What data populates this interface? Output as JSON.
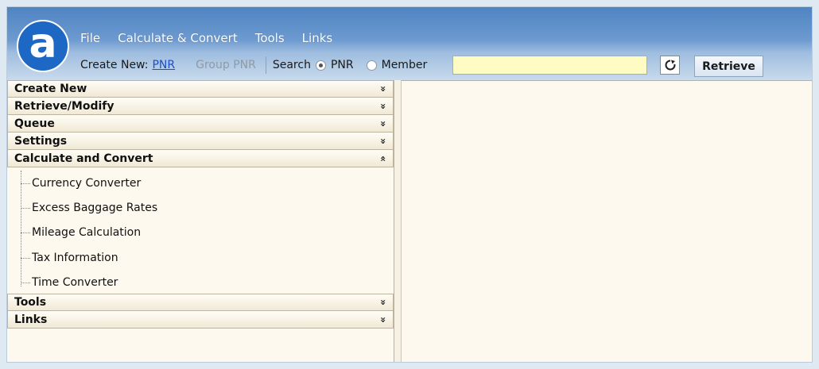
{
  "app": {
    "logo_letter": "a"
  },
  "menu": [
    "File",
    "Calculate & Convert",
    "Tools",
    "Links"
  ],
  "toolbar": {
    "create_new_label": "Create New:",
    "pnr_link": "PNR",
    "group_pnr": "Group PNR",
    "search_label": "Search",
    "radio_pnr": {
      "label": "PNR",
      "checked": true
    },
    "radio_member": {
      "label": "Member",
      "checked": false
    },
    "search_value": "",
    "search_placeholder": "",
    "retrieve_label": "Retrieve"
  },
  "icons": {
    "refresh": "refresh-icon",
    "expand": "double-chevron-down-icon",
    "collapse": "double-chevron-up-icon"
  },
  "sidebar": {
    "sections": [
      {
        "label": "Create New",
        "expanded": false
      },
      {
        "label": "Retrieve/Modify",
        "expanded": false
      },
      {
        "label": "Queue",
        "expanded": false
      },
      {
        "label": "Settings",
        "expanded": false
      },
      {
        "label": "Calculate and Convert",
        "expanded": true,
        "items": [
          "Currency Converter",
          "Excess Baggage Rates",
          "Mileage Calculation",
          "Tax Information",
          "Time Converter"
        ]
      },
      {
        "label": "Tools",
        "expanded": false
      },
      {
        "label": "Links",
        "expanded": false
      }
    ]
  },
  "colors": {
    "header_blue": "#4f84c2",
    "logo_blue": "#1d68c4",
    "link_blue": "#1f4fbf",
    "input_yellow": "#fefcc3",
    "panel_cream": "#fdf9ee"
  }
}
